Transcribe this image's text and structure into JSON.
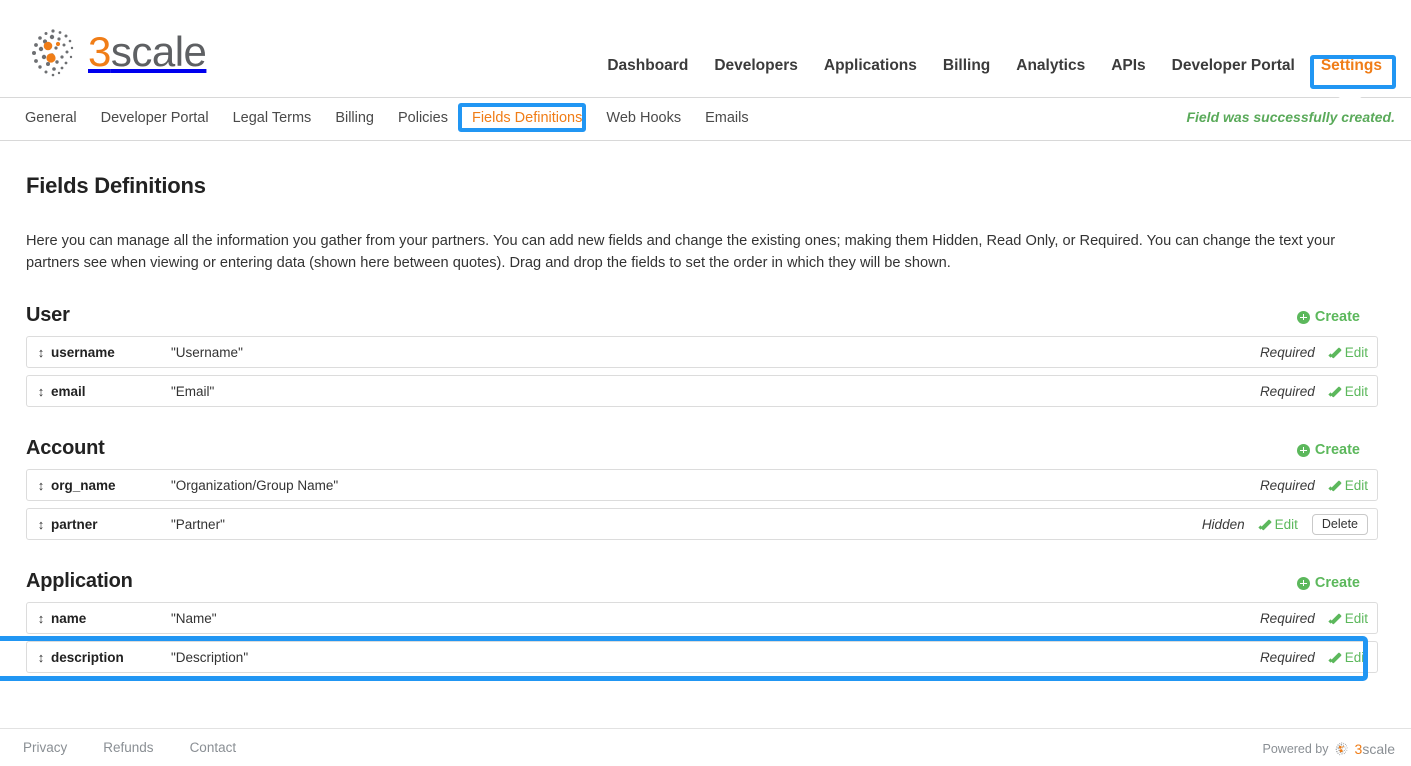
{
  "brand": {
    "logo_three": "3",
    "logo_scale": "scale",
    "accent_orange": "#f07d17",
    "logo_gray": "#5e6063",
    "highlight_blue": "#2196f3",
    "success_green": "#5aaa5a",
    "link_green": "#5cb85c"
  },
  "main_nav": [
    {
      "label": "Dashboard",
      "active": false
    },
    {
      "label": "Developers",
      "active": false
    },
    {
      "label": "Applications",
      "active": false
    },
    {
      "label": "Billing",
      "active": false
    },
    {
      "label": "Analytics",
      "active": false
    },
    {
      "label": "APIs",
      "active": false
    },
    {
      "label": "Developer Portal",
      "active": false
    },
    {
      "label": "Settings",
      "active": true
    }
  ],
  "sub_nav": [
    {
      "label": "General",
      "active": false
    },
    {
      "label": "Developer Portal",
      "active": false
    },
    {
      "label": "Legal Terms",
      "active": false
    },
    {
      "label": "Billing",
      "active": false
    },
    {
      "label": "Policies",
      "active": false
    },
    {
      "label": "Fields Definitions",
      "active": true
    },
    {
      "label": "Web Hooks",
      "active": false
    },
    {
      "label": "Emails",
      "active": false
    }
  ],
  "flash_message": "Field was successfully created.",
  "page": {
    "title": "Fields Definitions",
    "intro": "Here you can manage all the information you gather from your partners. You can add new fields and change the existing ones; making them Hidden, Read Only, or Required. You can change the text your partners see when viewing or entering data (shown here between quotes). Drag and drop the fields to set the order in which they will be shown."
  },
  "create_label": "Create",
  "edit_label": "Edit",
  "delete_label": "Delete",
  "drag_glyph": "↕",
  "sections": [
    {
      "title": "User",
      "rows": [
        {
          "name": "username",
          "label": "\"Username\"",
          "status": "Required",
          "has_delete": false,
          "highlighted": false
        },
        {
          "name": "email",
          "label": "\"Email\"",
          "status": "Required",
          "has_delete": false,
          "highlighted": false
        }
      ]
    },
    {
      "title": "Account",
      "rows": [
        {
          "name": "org_name",
          "label": "\"Organization/Group Name\"",
          "status": "Required",
          "has_delete": false,
          "highlighted": false
        },
        {
          "name": "partner",
          "label": "\"Partner\"",
          "status": "Hidden",
          "has_delete": true,
          "highlighted": true
        }
      ]
    },
    {
      "title": "Application",
      "rows": [
        {
          "name": "name",
          "label": "\"Name\"",
          "status": "Required",
          "has_delete": false,
          "highlighted": false
        },
        {
          "name": "description",
          "label": "\"Description\"",
          "status": "Required",
          "has_delete": false,
          "highlighted": false
        }
      ]
    }
  ],
  "footer": {
    "links": [
      "Privacy",
      "Refunds",
      "Contact"
    ],
    "powered_by": "Powered by",
    "powered_three": "3",
    "powered_scale": "scale"
  }
}
